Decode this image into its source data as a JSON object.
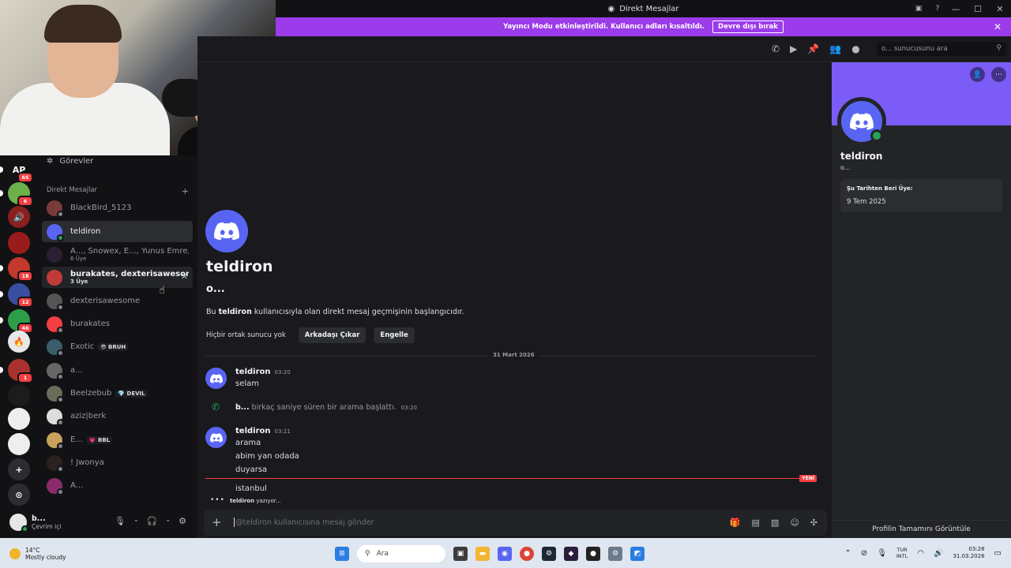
{
  "window": {
    "title": "Direkt Mesajlar",
    "controls": [
      "—",
      "☐",
      "✕"
    ]
  },
  "banner": {
    "text": "Yayıncı Modu etkinleştirildi. Kullanıcı adları kısaltıldı.",
    "button": "Devre dışı bırak"
  },
  "sidebar": {
    "tasks_label": "Görevler",
    "section_title": "Direkt Mesajlar",
    "add": "+",
    "dms": [
      {
        "name": "BlackBird_5123",
        "sub": "",
        "color": "#7a3b3b",
        "status": "#80848e"
      },
      {
        "name": "teldiron",
        "sub": "",
        "color": "#5865f2",
        "status": "#23a55a"
      },
      {
        "name": "A..., Snowex, E..., Yunus Emre, b...",
        "sub": "6 Üye",
        "color": "#2b2033",
        "status": ""
      },
      {
        "name": "burakates, dexterisawesome",
        "sub": "3 Üye",
        "color": "#c23b3b",
        "status": ""
      },
      {
        "name": "dexterisawesome",
        "sub": "",
        "color": "#555555",
        "status": "#80848e"
      },
      {
        "name": "burakates",
        "sub": "",
        "color": "#f23f43",
        "status": "#80848e"
      },
      {
        "name": "Exotic",
        "sub": "",
        "color": "#3b5d6b",
        "status": "#80848e",
        "tag": "BRUH",
        "tag_icon": "😎"
      },
      {
        "name": "a...",
        "sub": "",
        "color": "#666666",
        "status": "#80848e"
      },
      {
        "name": "Beelzebub",
        "sub": "",
        "color": "#6b6b5a",
        "status": "#80848e",
        "tag": "DEVIL",
        "tag_icon": "💎"
      },
      {
        "name": "aziz|berk",
        "sub": "",
        "color": "#dddddd",
        "status": "#80848e"
      },
      {
        "name": "E...",
        "sub": "",
        "color": "#c9a15c",
        "status": "#80848e",
        "tag": "BBL",
        "tag_icon": "💗"
      },
      {
        "name": "! Jwonya",
        "sub": "",
        "color": "#2a2220",
        "status": "#80848e"
      },
      {
        "name": "A...",
        "sub": "",
        "color": "#8a2b6b",
        "status": "#80848e"
      }
    ],
    "close_x": "✕"
  },
  "servers": [
    {
      "label": "AP",
      "badge": "65",
      "color": "#121214"
    },
    {
      "label": "",
      "badge": "6",
      "color": "#6bb04a"
    },
    {
      "label": "🔊",
      "badge": "",
      "color": "#8a1f1f"
    },
    {
      "label": "",
      "badge": "",
      "color": "#9a1b1b"
    },
    {
      "label": "",
      "badge": "18",
      "color": "#c0392b"
    },
    {
      "label": "",
      "badge": "12",
      "color": "#3a4ea0"
    },
    {
      "label": "",
      "badge": "46",
      "color": "#2e9d4a"
    },
    {
      "label": "🔥",
      "badge": "",
      "color": "#e8e8e8"
    },
    {
      "label": "",
      "badge": "1",
      "color": "#a8322d"
    },
    {
      "label": "",
      "badge": "",
      "color": "#1c1c1c"
    },
    {
      "label": "",
      "badge": "",
      "color": "#eeeeee"
    },
    {
      "label": "",
      "badge": "",
      "color": "#eeeeee"
    },
    {
      "label": "+",
      "badge": "",
      "color": "#2b2d31"
    },
    {
      "label": "⊙",
      "badge": "",
      "color": "#2b2d31"
    }
  ],
  "user": {
    "name": "b...",
    "status": "Çevrim içi"
  },
  "toolbar": {
    "search_placeholder": "o... sunucusunu ara",
    "icons": [
      "phone-icon",
      "video-icon",
      "pin-icon",
      "add-member-icon",
      "profile-icon"
    ]
  },
  "intro": {
    "name": "teldiron",
    "handle": "o...",
    "text_prefix": "Bu",
    "text_name": "teldiron",
    "text_suffix": "kullanıcısıyla olan direkt mesaj geçmişinin başlangıcıdır.",
    "mutual": "Hiçbir ortak sunucu yok",
    "remove_friend": "Arkadaşı Çıkar",
    "block": "Engelle"
  },
  "date_separator": "31 Mart 2026",
  "messages": [
    {
      "author": "teldiron",
      "time": "03:20",
      "lines": [
        "selam"
      ]
    },
    {
      "author": "teldiron",
      "time": "03:21",
      "lines": [
        "arama",
        "abim yan odada",
        "duyarsa"
      ]
    }
  ],
  "call": {
    "user": "b...",
    "text": "birkaç saniye süren bir arama başlattı.",
    "time": "03:20"
  },
  "new_label": "YENİ",
  "new_message": "istanbul",
  "typing": {
    "user": "teldiron",
    "text": "yazıyor..."
  },
  "composer": {
    "placeholder": "@teldiron kullanıcısına mesaj gönder"
  },
  "profile": {
    "name": "teldiron",
    "handle": "o...",
    "member_since_label": "Şu Tarihten Beri Üye:",
    "member_since": "9 Tem 2025",
    "view_full": "Profilin Tamamını Görüntüle"
  },
  "taskbar": {
    "temp": "14°C",
    "weather": "Mostly cloudy",
    "search": "Ara",
    "lang1": "TUR",
    "lang2": "INTL",
    "time": "03:28",
    "date": "31.03.2026"
  },
  "colors": {
    "accent": "#5865f2",
    "banner": "#9b3bea",
    "online": "#23a55a",
    "danger": "#f23f43"
  }
}
